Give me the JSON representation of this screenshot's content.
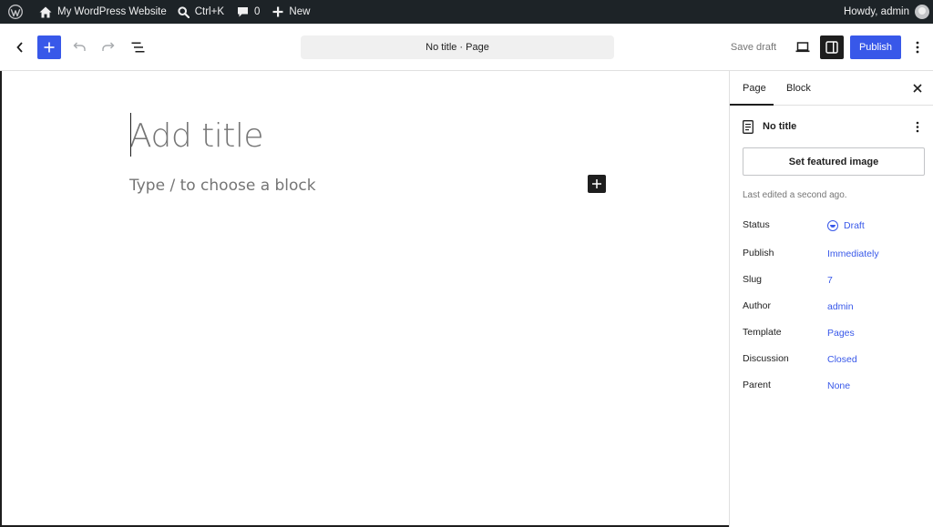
{
  "adminbar": {
    "site_name": "My WordPress Website",
    "search_shortcut": "Ctrl+K",
    "comments_count": "0",
    "new_label": "New",
    "howdy": "Howdy, admin",
    "icons": [
      "wordpress-logo-icon",
      "home-icon",
      "search-icon",
      "comment-icon",
      "plus-icon"
    ]
  },
  "header": {
    "doc_title": "No title · Page",
    "save_draft": "Save draft",
    "publish": "Publish",
    "icons": [
      "back-icon",
      "add-block-icon",
      "undo-icon",
      "redo-icon",
      "document-overview-icon",
      "preview-icon",
      "settings-icon",
      "options-icon"
    ]
  },
  "canvas": {
    "title_placeholder": "Add title",
    "block_placeholder": "Type / to choose a block"
  },
  "sidebar": {
    "tabs": [
      {
        "label": "Page"
      },
      {
        "label": "Block"
      }
    ],
    "doc_title": "No title",
    "featured_image": "Set featured image",
    "last_edited": "Last edited a second ago.",
    "rows": [
      {
        "label": "Status",
        "value": "Draft"
      },
      {
        "label": "Publish",
        "value": "Immediately"
      },
      {
        "label": "Slug",
        "value": "7"
      },
      {
        "label": "Author",
        "value": "admin"
      },
      {
        "label": "Template",
        "value": "Pages"
      },
      {
        "label": "Discussion",
        "value": "Closed"
      },
      {
        "label": "Parent",
        "value": "None"
      }
    ]
  },
  "colors": {
    "accent": "#3858e9",
    "adminbar_bg": "#1d2327",
    "dark": "#1e1e1e",
    "muted": "#757575"
  }
}
